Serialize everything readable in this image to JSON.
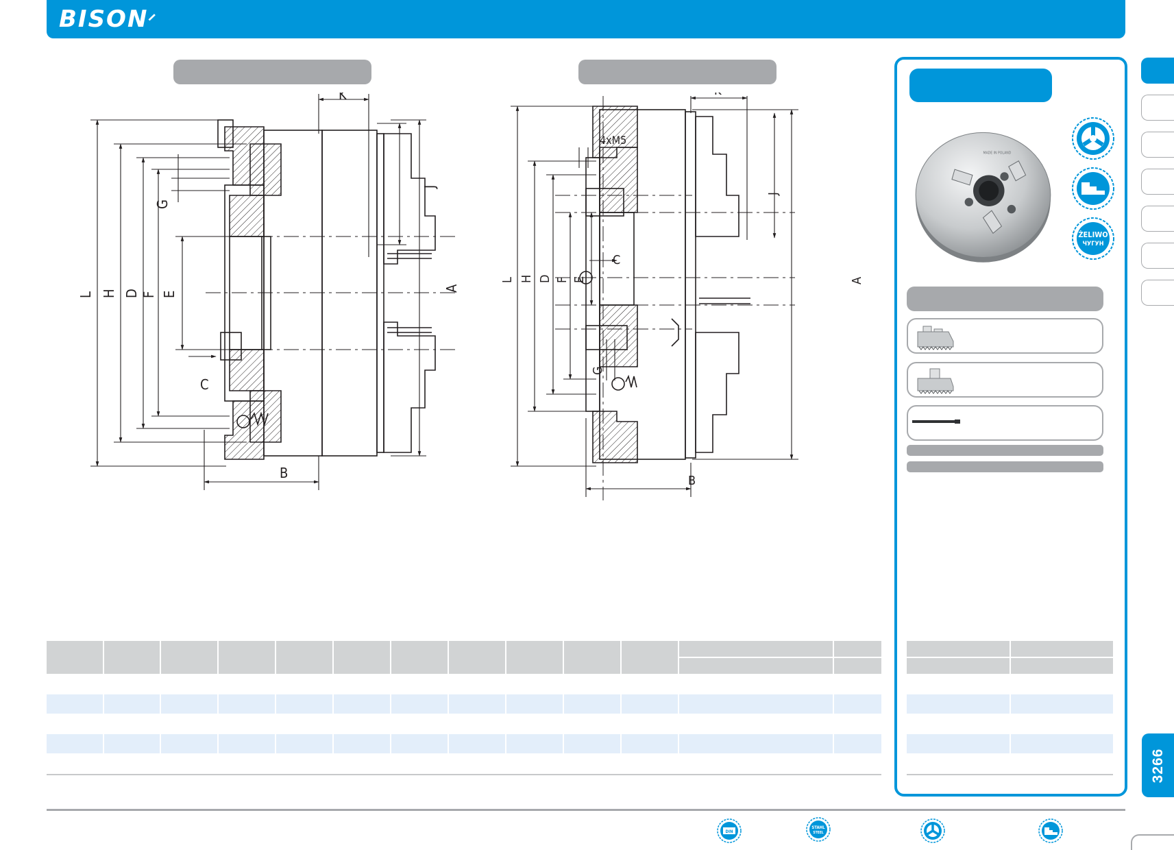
{
  "brand": {
    "name": "BISON",
    "color": "#0096da"
  },
  "drawing": {
    "left_labels": [
      "L",
      "H",
      "D",
      "F",
      "E",
      "G",
      "C",
      "B",
      "K",
      "J",
      "A"
    ],
    "right_labels": [
      "L",
      "H",
      "D",
      "F",
      "E",
      "G",
      "C",
      "B",
      "K",
      "J",
      "A",
      "4xM5"
    ]
  },
  "sidebar": {
    "badges": [
      "three-jaw-icon",
      "steel-body-icon",
      "cast-iron-icon"
    ],
    "badge_texts": {
      "zeliwo": "ŻELIWO",
      "chugun": "ЧУГУН"
    },
    "product_image_texts": [
      "MADE IN POLAND"
    ],
    "accessories": [
      "solid-jaws-outside",
      "solid-jaws-inside",
      "chuck-key"
    ]
  },
  "tables": {
    "main": {
      "columns": 13,
      "body_rows": 5
    },
    "side": {
      "columns": 2,
      "body_rows": 5
    }
  },
  "footer": {
    "badges": [
      "din-standard-icon",
      "stahl-steel-icon",
      "three-jaw-icon",
      "stepped-jaws-icon"
    ],
    "badge_texts": {
      "stahl": "STAHL",
      "steel": "STEEL",
      "din": "DIN"
    }
  },
  "page": {
    "number": "3266"
  },
  "colors": {
    "accent": "#0096da",
    "grey": "#a7a9ac",
    "table_header": "#d1d3d4",
    "row_stripe": "#e3eefa"
  }
}
